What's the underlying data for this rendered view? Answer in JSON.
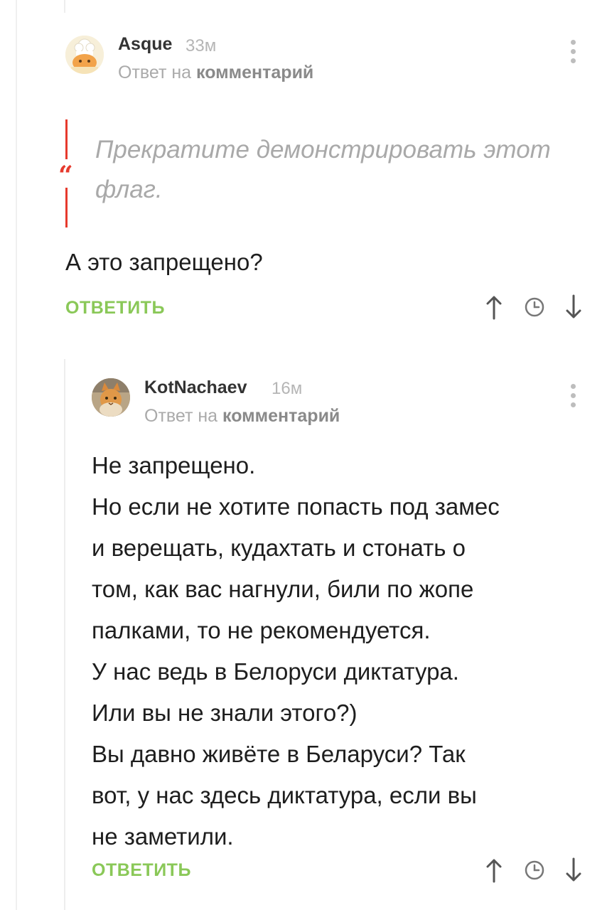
{
  "comment1": {
    "username": "Asque",
    "time": "33м",
    "reply_prefix": "Ответ на",
    "reply_link": "комментарий",
    "quote": "Прекратите демонстрировать этот флаг.",
    "text": "А это запрещено?",
    "reply_label": "ОТВЕТИТЬ"
  },
  "comment2": {
    "username": "KotNachaev",
    "time": "16м",
    "reply_prefix": "Ответ на",
    "reply_link": "комментарий",
    "text_lines": [
      "Не запрещено.",
      "Но если не хотите попасть под замес",
      "и верещать, кудахтать и стонать о",
      "том, как вас нагнули, били по жопе",
      "палками, то не рекомендуется.",
      "У нас ведь в Белоруси диктатура.",
      "Или вы не знали этого?)",
      "Вы давно живёте в Беларуси? Так",
      "вот, у нас здесь диктатура, если вы",
      "не заметили."
    ],
    "reply_label": "ОТВЕТИТЬ"
  },
  "icons": {
    "up": "arrow-up-icon",
    "clock": "clock-icon",
    "down": "arrow-down-icon",
    "menu": "more-vertical-icon"
  },
  "colors": {
    "accent_green": "#8ac858",
    "quote_red": "#e63a2d",
    "muted_gray": "#aaaaaa"
  }
}
